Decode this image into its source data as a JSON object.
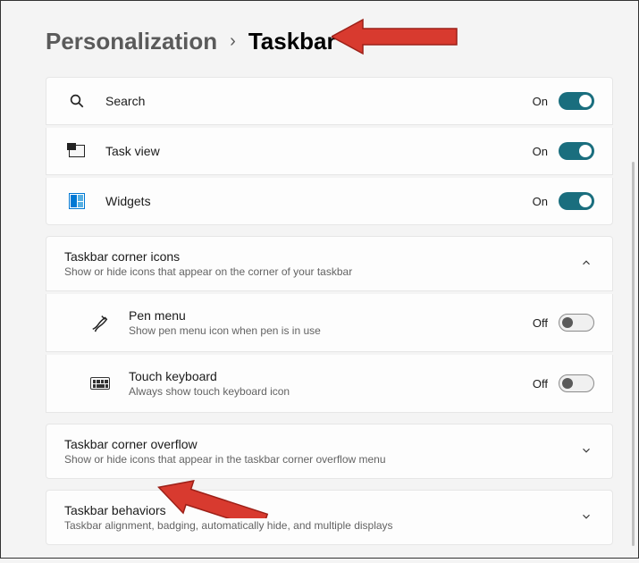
{
  "breadcrumb": {
    "parent": "Personalization",
    "sep": "›",
    "current": "Taskbar"
  },
  "items": {
    "search": {
      "label": "Search",
      "state": "On"
    },
    "taskview": {
      "label": "Task view",
      "state": "On"
    },
    "widgets": {
      "label": "Widgets",
      "state": "On"
    }
  },
  "cornerIcons": {
    "title": "Taskbar corner icons",
    "desc": "Show or hide icons that appear on the corner of your taskbar",
    "pen": {
      "label": "Pen menu",
      "desc": "Show pen menu icon when pen is in use",
      "state": "Off"
    },
    "touch": {
      "label": "Touch keyboard",
      "desc": "Always show touch keyboard icon",
      "state": "Off"
    }
  },
  "overflow": {
    "title": "Taskbar corner overflow",
    "desc": "Show or hide icons that appear in the taskbar corner overflow menu"
  },
  "behaviors": {
    "title": "Taskbar behaviors",
    "desc": "Taskbar alignment, badging, automatically hide, and multiple displays"
  }
}
